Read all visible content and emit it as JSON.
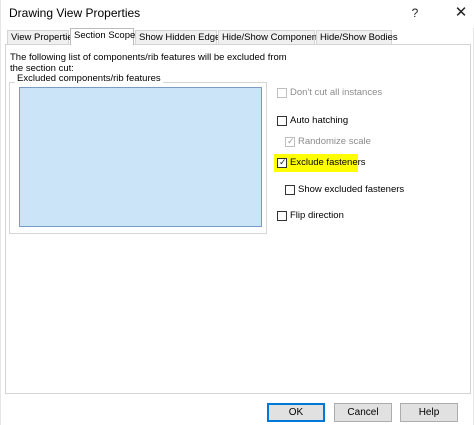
{
  "window": {
    "title": "Drawing View Properties",
    "help_glyph": "?",
    "close_glyph": "✕"
  },
  "tabs": [
    {
      "label": "View Properties",
      "active": false
    },
    {
      "label": "Section Scope",
      "active": true
    },
    {
      "label": "Show Hidden Edges",
      "active": false
    },
    {
      "label": "Hide/Show Components",
      "active": false
    },
    {
      "label": "Hide/Show Bodies",
      "active": false
    }
  ],
  "section_scope": {
    "description": "The following list of components/rib features will be excluded from the section cut:",
    "group_label": "Excluded components/rib features",
    "excluded_items": [],
    "options": {
      "dont_cut_all_instances": {
        "label": "Don't cut all instances",
        "checked": false,
        "enabled": false
      },
      "auto_hatching": {
        "label": "Auto hatching",
        "checked": false,
        "enabled": true
      },
      "randomize_scale": {
        "label": "Randomize scale",
        "checked": true,
        "enabled": false
      },
      "exclude_fasteners": {
        "label": "Exclude fasteners",
        "checked": true,
        "enabled": true,
        "highlighted": true
      },
      "show_excluded_fasteners": {
        "label": "Show excluded fasteners",
        "checked": false,
        "enabled": true
      },
      "flip_direction": {
        "label": "Flip direction",
        "checked": false,
        "enabled": true
      }
    }
  },
  "buttons": {
    "ok": "OK",
    "cancel": "Cancel",
    "help": "Help"
  },
  "colors": {
    "listbox_bg": "#cce4f7",
    "highlight": "#ffff00",
    "default_button_border": "#0078d7"
  },
  "icons": {
    "check": "✓"
  }
}
